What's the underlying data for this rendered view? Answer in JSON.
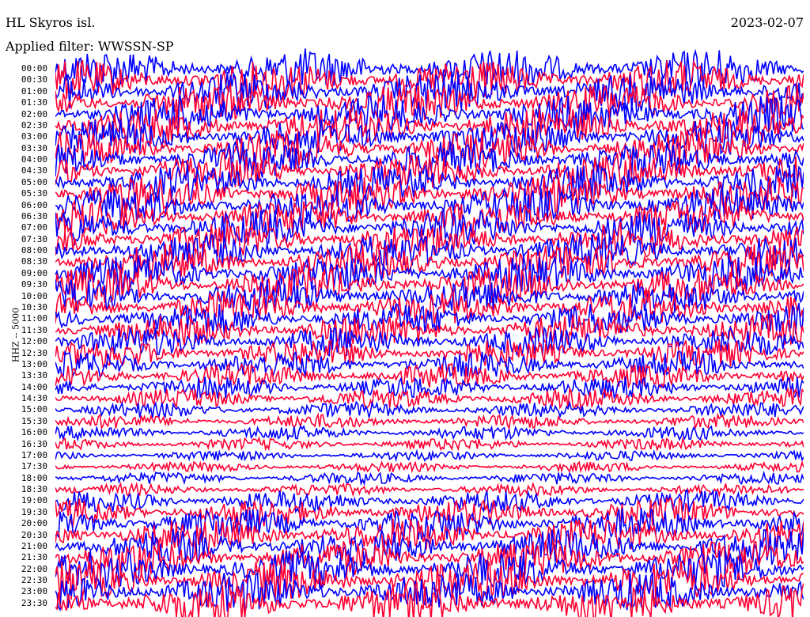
{
  "header": {
    "title": "HL Skyros isl.",
    "date": "2023-02-07",
    "filter": "Applied filter: WWSSN-SP"
  },
  "chart_data": {
    "type": "line",
    "title": "HL Skyros isl.",
    "ylabel": "HHZ -- 5000",
    "xlabel": "",
    "tick_labels": [
      "00:00",
      "00:30",
      "01:00",
      "01:30",
      "02:00",
      "02:30",
      "03:00",
      "03:30",
      "04:00",
      "04:30",
      "05:00",
      "05:30",
      "06:00",
      "06:30",
      "07:00",
      "07:30",
      "08:00",
      "08:30",
      "09:00",
      "09:30",
      "10:00",
      "10:30",
      "11:00",
      "11:30",
      "12:00",
      "12:30",
      "13:00",
      "13:30",
      "14:00",
      "14:30",
      "15:00",
      "15:30",
      "16:00",
      "16:30",
      "17:00",
      "17:30",
      "18:00",
      "18:30",
      "19:00",
      "19:30",
      "20:00",
      "20:30",
      "21:00",
      "21:30",
      "22:00",
      "22:30",
      "23:00",
      "23:30"
    ],
    "row_amplitude": [
      1.0,
      1.0,
      1.0,
      0.95,
      0.95,
      0.95,
      0.9,
      0.9,
      0.9,
      0.9,
      0.9,
      0.9,
      0.9,
      0.9,
      0.9,
      0.9,
      0.9,
      0.9,
      0.9,
      0.9,
      0.85,
      0.85,
      0.8,
      0.8,
      0.75,
      0.7,
      0.65,
      0.6,
      0.55,
      0.5,
      0.4,
      0.35,
      0.35,
      0.3,
      0.25,
      0.25,
      0.3,
      0.3,
      0.55,
      0.7,
      0.8,
      0.85,
      0.9,
      0.9,
      0.95,
      1.0,
      1.0,
      1.0
    ],
    "series": [
      {
        "name": "",
        "color": "#0000ff"
      },
      {
        "name": "",
        "color": "#ff0033"
      }
    ]
  }
}
